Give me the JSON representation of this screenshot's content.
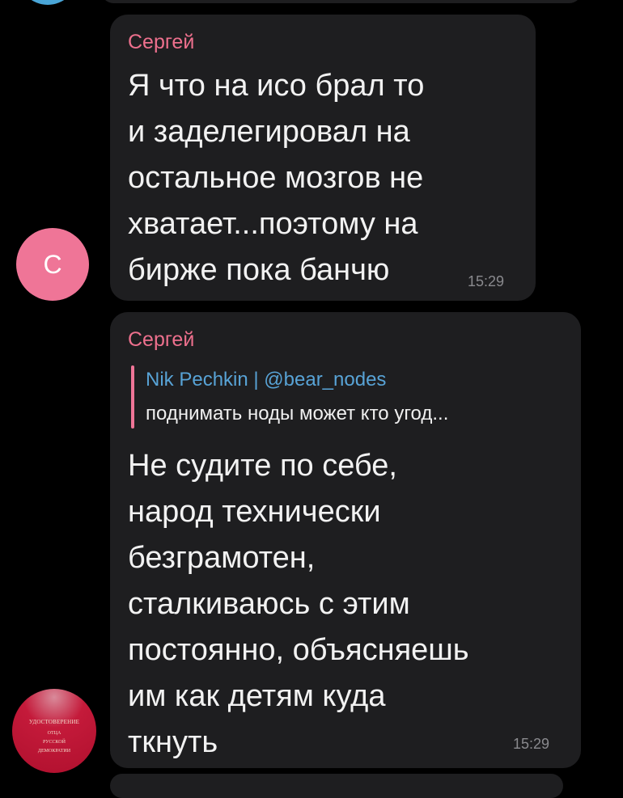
{
  "colors": {
    "background": "#000000",
    "bubble": "#1e1e20",
    "sender_name": "#ed708d",
    "quote_author": "#58a3d6",
    "avatar_c": "#ef7597",
    "timestamp": "#8a8a8e"
  },
  "messages": [
    {
      "sender": "Сергей",
      "avatar_letter": "С",
      "text": "Я что на исо брал то\nи заделегировал  на\nостальное мозгов не\nхватает...поэтому на\nбирже пока банчю",
      "time": "15:29"
    },
    {
      "sender": "Сергей",
      "avatar_text": [
        "УДОСТОВЕРЕНИЕ",
        "ОТЦА",
        "РУССКОЙ",
        "ДЕМОКРАТИИ"
      ],
      "reply": {
        "author": "Nik Pechkin | @bear_nodes",
        "text": "поднимать ноды может кто угод..."
      },
      "text": "Не судите по себе,\nнарод технически\nбезграмотен,\nсталкиваюсь с этим\nпостоянно, объясняешь\nим как детям куда\nткнуть",
      "time": "15:29"
    }
  ]
}
